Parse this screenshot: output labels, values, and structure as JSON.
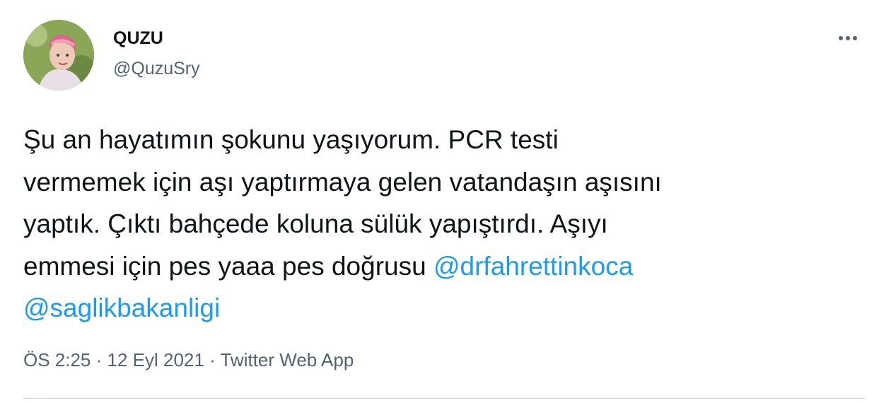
{
  "user": {
    "display_name": "QUZU",
    "handle": "@QuzuSry"
  },
  "tweet": {
    "line1": "Şu an hayatımın şokunu yaşıyorum. PCR testi",
    "line2": "vermemek için aşı yaptırmaya gelen vatandaşın aşısını",
    "line3": "yaptık. Çıktı bahçede koluna sülük yapıştırdı. Aşıyı",
    "line4_text": "emmesi için pes yaaa pes doğrusu ",
    "mention1": "@drfahrettinkoca",
    "mention2": "@saglikbakanligi"
  },
  "meta": {
    "time": "ÖS 2:25",
    "separator1": " · ",
    "date": "12 Eyl 2021",
    "separator2": " · ",
    "source": "Twitter Web App"
  },
  "icons": {
    "more": "more-horizontal-icon"
  },
  "colors": {
    "text": "#0f1419",
    "secondary": "#536471",
    "link": "#1d9bf0",
    "divider": "#cfd9de"
  }
}
